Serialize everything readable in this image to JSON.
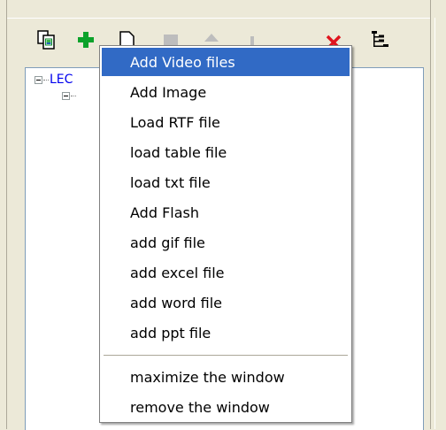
{
  "toolbar": {
    "buttons": [
      {
        "icon": "copy-icon"
      },
      {
        "icon": "add-icon"
      },
      {
        "icon": "paste-icon"
      },
      {
        "icon": "properties-icon"
      },
      {
        "icon": "move-up-icon"
      },
      {
        "icon": "move-down-icon"
      },
      {
        "icon": "delete-icon"
      },
      {
        "icon": "tree-view-icon"
      }
    ]
  },
  "tree": {
    "root_label": "LEC"
  },
  "context_menu": {
    "items": [
      "Add Video files",
      "Add Image",
      "Load RTF file",
      "load table file",
      "load txt file",
      "Add Flash",
      "add gif file",
      "add excel file",
      "add word file",
      "add ppt file"
    ],
    "window_items": [
      "maximize the window",
      "remove the window"
    ],
    "highlighted_index": 0,
    "highlight_color": "#316ac5"
  }
}
